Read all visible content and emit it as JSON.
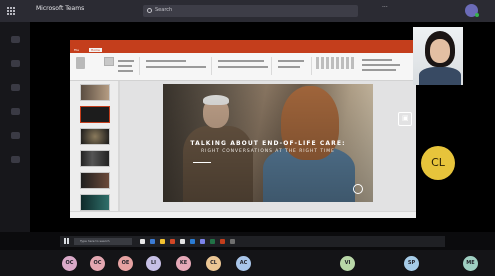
{
  "titlebar": {
    "app_name": "Microsoft Teams",
    "search_placeholder": "Search",
    "more": "···"
  },
  "slide": {
    "title": "TALKING ABOUT END-OF-LIFE CARE:",
    "subtitle": "RIGHT CONVERSATIONS AT THE RIGHT TIME"
  },
  "ribbon": {
    "tab_file": "File",
    "tab_home": "Home"
  },
  "pin_glyph": "▣",
  "participant": {
    "initials": "CL"
  },
  "taskbar": {
    "search_placeholder": "Type here to search"
  },
  "attendees": [
    {
      "initials": "OC",
      "color": "#d9a9c8"
    },
    {
      "initials": "OC",
      "color": "#e3a7b1"
    },
    {
      "initials": "OE",
      "color": "#e6a2a2"
    },
    {
      "initials": "LI",
      "color": "#c7c0e6"
    },
    {
      "initials": "KE",
      "color": "#e6a9b8"
    },
    {
      "initials": "CL",
      "color": "#ebc694"
    },
    {
      "initials": "AC",
      "color": "#a9c6ea"
    },
    {
      "initials": "VI",
      "color": "#b9d7a8"
    },
    {
      "initials": "SP",
      "color": "#a6cce8"
    },
    {
      "initials": "ME",
      "color": "#9fcfc2"
    }
  ],
  "colors": {
    "teams_bg": "#0b0b0d",
    "powerpoint_accent": "#c43e1c",
    "participant_avatar": "#e7c43b"
  },
  "icons": [
    "app-grid-icon",
    "search-icon",
    "pin-icon",
    "windows-start-icon"
  ]
}
